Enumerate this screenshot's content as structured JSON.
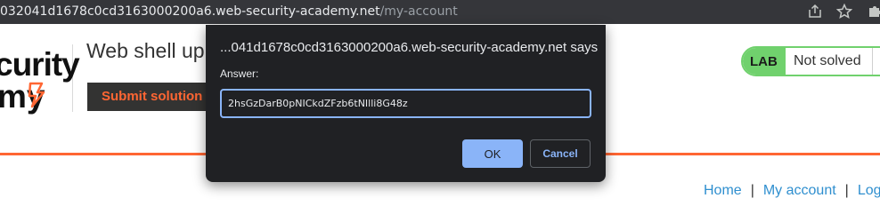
{
  "browser": {
    "url_host": "032041d1678c0cd3163000200a6.web-security-academy.net",
    "url_path": "/my-account",
    "icons": [
      "share-icon",
      "bookmark-star-icon",
      "extensions-icon"
    ]
  },
  "header": {
    "logo_line1": "curity",
    "logo_line2": "my",
    "lab_title": "Web shell up",
    "submit_label": "Submit solution",
    "status_badge": "LAB",
    "status_text": "Not solved"
  },
  "nav": {
    "home": "Home",
    "separator": "|",
    "account": "My account",
    "logout": "Log"
  },
  "dialog": {
    "title": "...041d1678c0cd3163000200a6.web-security-academy.net says",
    "label": "Answer:",
    "input_value": "2hsGzDarB0pNICkdZFzb6tNIlli8G48z",
    "ok_label": "OK",
    "cancel_label": "Cancel"
  },
  "colors": {
    "accent": "#ff6633",
    "status_green": "#70d16d",
    "dialog_bg": "#202124",
    "dialog_accent": "#8ab4f8"
  }
}
